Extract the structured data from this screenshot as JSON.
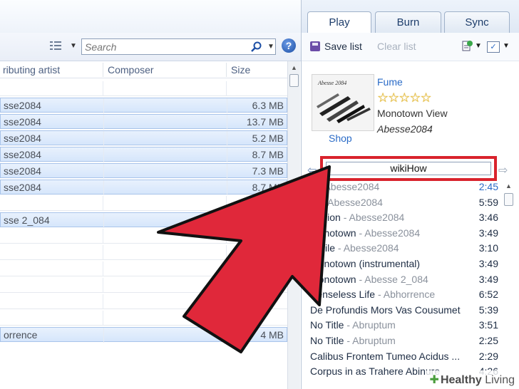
{
  "search": {
    "placeholder": "Search"
  },
  "columns": {
    "artist": "ributing artist",
    "composer": "Composer",
    "size": "Size"
  },
  "library_rows": [
    {
      "artist": "",
      "size": "",
      "selected": false
    },
    {
      "artist": "sse2084",
      "size": "6.3 MB",
      "selected": true
    },
    {
      "artist": "sse2084",
      "size": "13.7 MB",
      "selected": true
    },
    {
      "artist": "sse2084",
      "size": "5.2 MB",
      "selected": true
    },
    {
      "artist": "sse2084",
      "size": "8.7 MB",
      "selected": true
    },
    {
      "artist": "sse2084",
      "size": "7.3 MB",
      "selected": true
    },
    {
      "artist": "sse2084",
      "size": "8.7 MB",
      "selected": true
    },
    {
      "artist": "",
      "size": "",
      "selected": false
    },
    {
      "artist": "sse 2_084",
      "size": "",
      "selected": true
    },
    {
      "artist": "",
      "size": "",
      "selected": false
    },
    {
      "artist": "",
      "size": "",
      "selected": false
    },
    {
      "artist": "",
      "size": "",
      "selected": false
    },
    {
      "artist": "",
      "size": "",
      "selected": false
    },
    {
      "artist": "",
      "size": "",
      "selected": false
    },
    {
      "artist": "",
      "size": "",
      "selected": false
    },
    {
      "artist": "orrence",
      "size": "4 MB",
      "selected": true
    }
  ],
  "tabs": {
    "play": "Play",
    "burn": "Burn",
    "sync": "Sync"
  },
  "actions": {
    "save_list": "Save list",
    "clear_list": "Clear list"
  },
  "now_playing": {
    "title": "Fume",
    "rating": "☆☆☆☆☆",
    "album": "Monotown View",
    "artist": "Abesse2084",
    "shop": "Shop",
    "album_art_text": "Abesse 2084"
  },
  "list_name": "wikiHow",
  "playlist": [
    {
      "title": "e",
      "artist": "Abesse2084",
      "duration": "2:45",
      "playing": true
    },
    {
      "title": "re",
      "artist": "Abesse2084",
      "duration": "5:59",
      "playing": false
    },
    {
      "title": "ollision",
      "artist": "Abesse2084",
      "duration": "3:46",
      "playing": false
    },
    {
      "title": "Monotown",
      "artist": "Abesse2084",
      "duration": "3:49",
      "playing": false
    },
    {
      "title": "Smile",
      "artist": "Abesse2084",
      "duration": "3:10",
      "playing": false
    },
    {
      "title": "Monotown (instrumental)",
      "artist": "",
      "duration": "3:49",
      "playing": false
    },
    {
      "title": "Monotown",
      "artist": "Abesse 2_084",
      "duration": "3:49",
      "playing": false
    },
    {
      "title": "Senseless Life",
      "artist": "Abhorrence",
      "duration": "6:52",
      "playing": false
    },
    {
      "title": "De Profundis Mors Vas Cousumet",
      "artist": "",
      "duration": "5:39",
      "playing": false
    },
    {
      "title": "No Title",
      "artist": "Abruptum",
      "duration": "3:51",
      "playing": false
    },
    {
      "title": "No Title",
      "artist": "Abruptum",
      "duration": "2:25",
      "playing": false
    },
    {
      "title": "Calibus Frontem Tumeo Acidus ...",
      "artist": "",
      "duration": "2:29",
      "playing": false
    },
    {
      "title": "Corpus in as Trahere Abinure",
      "artist": "",
      "duration": "4:26",
      "playing": false
    }
  ],
  "watermark": {
    "prefix": "Healthy",
    "suffix": " Living"
  },
  "colors": {
    "arrow_fill": "#e0283a",
    "arrow_stroke": "#111111",
    "highlight_box": "#d9232d",
    "accent_blue": "#2a6bc7"
  }
}
